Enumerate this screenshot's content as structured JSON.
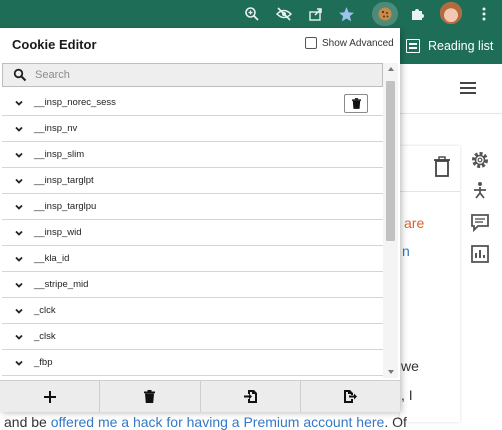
{
  "popup": {
    "title": "Cookie Editor",
    "show_advanced_label": "Show Advanced",
    "show_advanced_checked": false,
    "search_placeholder": "Search",
    "cookies": [
      {
        "name": "__insp_norec_sess"
      },
      {
        "name": "__insp_nv"
      },
      {
        "name": "__insp_slim"
      },
      {
        "name": "__insp_targlpt"
      },
      {
        "name": "__insp_targlpu"
      },
      {
        "name": "__insp_wid"
      },
      {
        "name": "__kla_id"
      },
      {
        "name": "__stripe_mid"
      },
      {
        "name": "_clck"
      },
      {
        "name": "_clsk"
      },
      {
        "name": "_fbp"
      }
    ],
    "actions": [
      {
        "name": "add-cookie-button",
        "icon": "plus-icon"
      },
      {
        "name": "delete-all-button",
        "icon": "trash-icon"
      },
      {
        "name": "import-button",
        "icon": "import-icon"
      },
      {
        "name": "export-button",
        "icon": "export-icon"
      }
    ]
  },
  "browser": {
    "toolbar_icons": [
      "zoom-icon",
      "eye-slash-icon",
      "share-icon",
      "star-icon",
      "cookie-icon",
      "puzzle-icon",
      "avatar",
      "more-vert-icon"
    ],
    "reading_list_label": "Reading list",
    "colors": {
      "toolbar": "#1e6e57",
      "link": "#3478c6",
      "orange_link": "#d9622b"
    }
  },
  "page": {
    "frag_are": "are",
    "frag_n": "n",
    "frag_we": "we",
    "frag_comma": ", I",
    "bottom_prefix": "and be ",
    "bottom_link": "offered me a hack for having a Premium account here",
    "bottom_suffix": ". Of"
  }
}
